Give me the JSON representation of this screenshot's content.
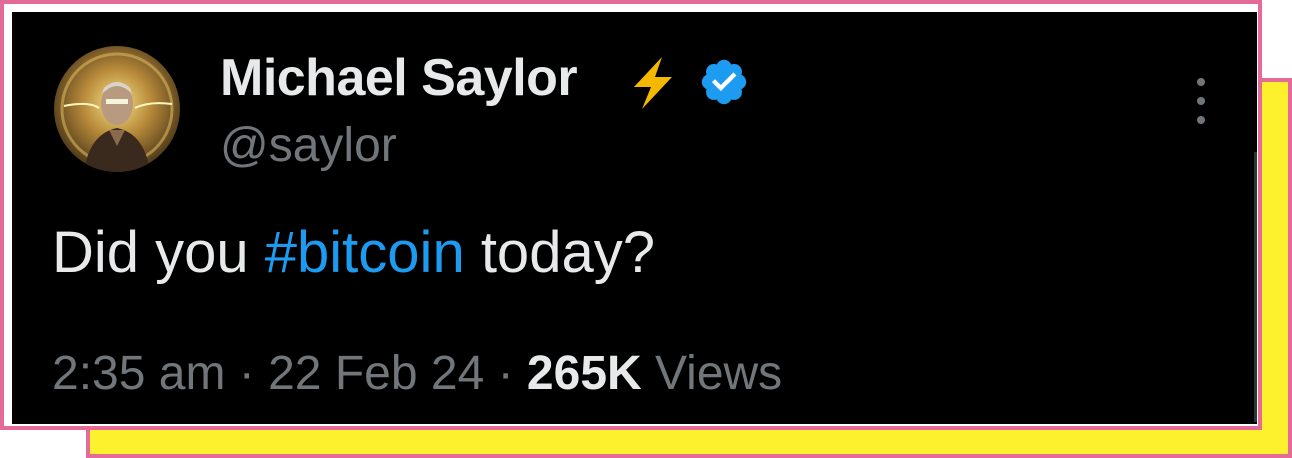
{
  "tweet": {
    "display_name": "Michael Saylor",
    "name_emoji": "lightning-bolt-icon",
    "verified": true,
    "handle": "@saylor",
    "text_before": "Did you ",
    "hashtag": "#bitcoin",
    "text_after": " today?",
    "time": "2:35 am",
    "separator": " · ",
    "date": "22 Feb 24",
    "views_count": "265K",
    "views_label": " Views"
  },
  "colors": {
    "background": "#000000",
    "text_primary": "#e7e9ea",
    "text_secondary": "#71767b",
    "link": "#1d9bf0",
    "verified_badge": "#1d9bf0",
    "frame_pink": "#e46b97",
    "frame_yellow": "#fdf12d"
  }
}
